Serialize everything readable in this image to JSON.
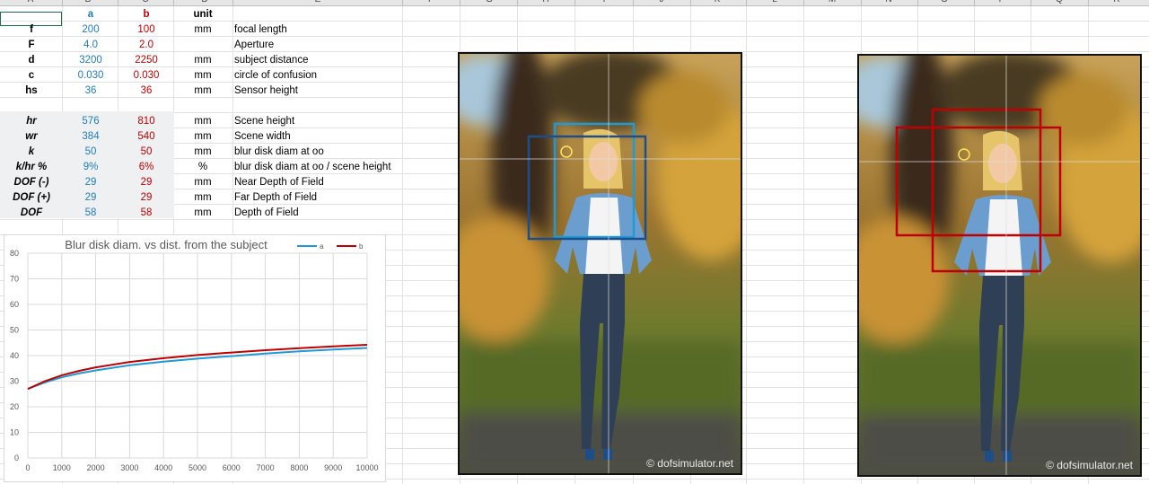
{
  "columns": [
    "A",
    "B",
    "C",
    "D",
    "E",
    "F",
    "G",
    "H",
    "I",
    "J",
    "K",
    "L",
    "M",
    "N",
    "O",
    "P",
    "Q",
    "R"
  ],
  "header": {
    "a": "a",
    "b": "b",
    "unit": "unit"
  },
  "params": [
    {
      "name": "f",
      "a": "200",
      "b": "100",
      "unit": "mm",
      "desc": "focal length"
    },
    {
      "name": "F",
      "a": "4.0",
      "b": "2.0",
      "unit": "",
      "desc": "Aperture"
    },
    {
      "name": "d",
      "a": "3200",
      "b": "2250",
      "unit": "mm",
      "desc": "subject distance"
    },
    {
      "name": "c",
      "a": "0.030",
      "b": "0.030",
      "unit": "mm",
      "desc": "circle of confusion"
    },
    {
      "name": "hs",
      "a": "36",
      "b": "36",
      "unit": "mm",
      "desc": "Sensor height"
    }
  ],
  "results": [
    {
      "name": "hr",
      "a": "576",
      "b": "810",
      "unit": "mm",
      "desc": "Scene height"
    },
    {
      "name": "wr",
      "a": "384",
      "b": "540",
      "unit": "mm",
      "desc": "Scene width"
    },
    {
      "name": "k",
      "a": "50",
      "b": "50",
      "unit": "mm",
      "desc": "blur disk diam at oo"
    },
    {
      "name": "k/hr %",
      "a": "9%",
      "b": "6%",
      "unit": "%",
      "desc": "blur disk diam at oo / scene height"
    },
    {
      "name": "DOF (-)",
      "a": "29",
      "b": "29",
      "unit": "mm",
      "desc": "Near Depth of Field"
    },
    {
      "name": "DOF (+)",
      "a": "29",
      "b": "29",
      "unit": "mm",
      "desc": "Far Depth of Field"
    },
    {
      "name": "DOF",
      "a": "58",
      "b": "58",
      "unit": "mm",
      "desc": "Depth of Field"
    }
  ],
  "watermark": "© dofsimulator.net",
  "colors": {
    "a": "#1e9bd7",
    "b": "#c00000"
  },
  "chart_data": {
    "type": "line",
    "title": "Blur disk diam. vs dist. from the subject",
    "x": [
      0,
      500,
      1000,
      1500,
      2000,
      3000,
      4000,
      5000,
      6000,
      7000,
      8000,
      9000,
      10000
    ],
    "series": [
      {
        "name": "a",
        "values": [
          27,
          29.5,
          31.5,
          33,
          34.2,
          36.2,
          37.6,
          38.8,
          39.8,
          40.8,
          41.7,
          42.4,
          43
        ]
      },
      {
        "name": "b",
        "values": [
          27,
          30,
          32.3,
          34,
          35.4,
          37.5,
          39,
          40.2,
          41.2,
          42.1,
          42.9,
          43.6,
          44.2
        ]
      }
    ],
    "xticks": [
      0,
      1000,
      2000,
      3000,
      4000,
      5000,
      6000,
      7000,
      8000,
      9000,
      10000
    ],
    "yticks": [
      0,
      10,
      20,
      30,
      40,
      50,
      60,
      70,
      80
    ],
    "xlim": [
      0,
      10000
    ],
    "ylim": [
      0,
      80
    ],
    "grid": true,
    "legend": "top-right"
  }
}
